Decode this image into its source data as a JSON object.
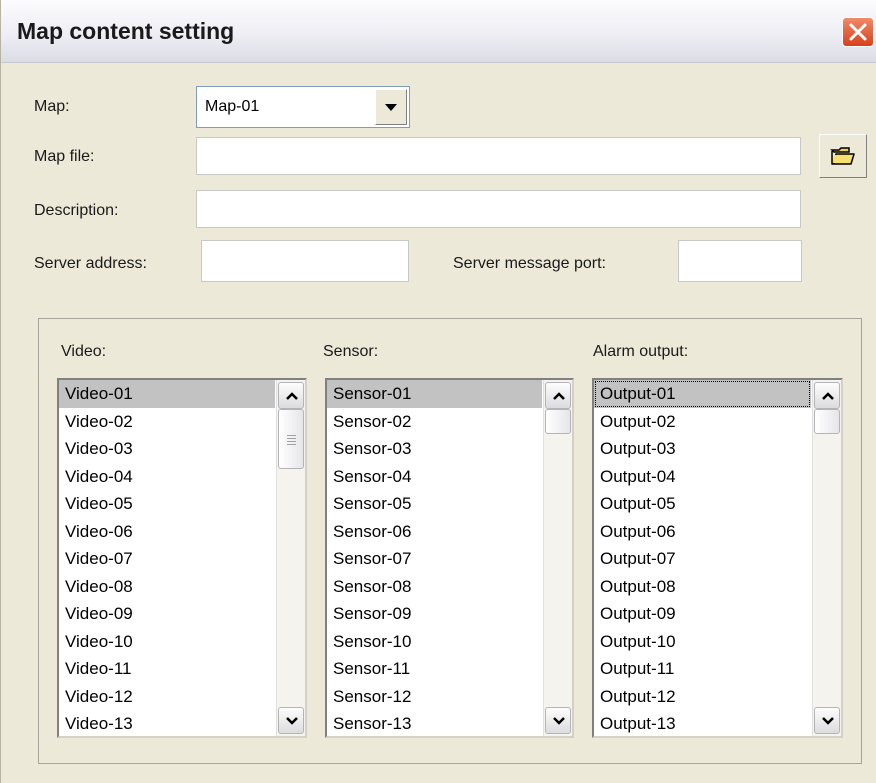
{
  "window": {
    "title": "Map content setting"
  },
  "form": {
    "map_label": "Map:",
    "map_value": "Map-01",
    "map_file_label": "Map file:",
    "map_file_value": "",
    "description_label": "Description:",
    "description_value": "",
    "server_address_label": "Server address:",
    "server_address_value": "",
    "server_port_label": "Server message port:",
    "server_port_value": ""
  },
  "lists": {
    "video": {
      "label": "Video:",
      "items": [
        "Video-01",
        "Video-02",
        "Video-03",
        "Video-04",
        "Video-05",
        "Video-06",
        "Video-07",
        "Video-08",
        "Video-09",
        "Video-10",
        "Video-11",
        "Video-12",
        "Video-13"
      ],
      "selected": "Video-01"
    },
    "sensor": {
      "label": "Sensor:",
      "items": [
        "Sensor-01",
        "Sensor-02",
        "Sensor-03",
        "Sensor-04",
        "Sensor-05",
        "Sensor-06",
        "Sensor-07",
        "Sensor-08",
        "Sensor-09",
        "Sensor-10",
        "Sensor-11",
        "Sensor-12",
        "Sensor-13"
      ],
      "selected": "Sensor-01"
    },
    "output": {
      "label": "Alarm output:",
      "items": [
        "Output-01",
        "Output-02",
        "Output-03",
        "Output-04",
        "Output-05",
        "Output-06",
        "Output-07",
        "Output-08",
        "Output-09",
        "Output-10",
        "Output-11",
        "Output-12",
        "Output-13"
      ],
      "selected": "Output-01"
    }
  },
  "icons": {
    "close": "close-icon",
    "browse": "folder-icon",
    "dropdown": "chevron-down-icon",
    "scroll_up": "chevron-up-icon",
    "scroll_down": "chevron-down-icon"
  },
  "colors": {
    "close_button": "#d8401c",
    "dialog_background": "#ece9d8",
    "selection": "#c2c2c2"
  }
}
